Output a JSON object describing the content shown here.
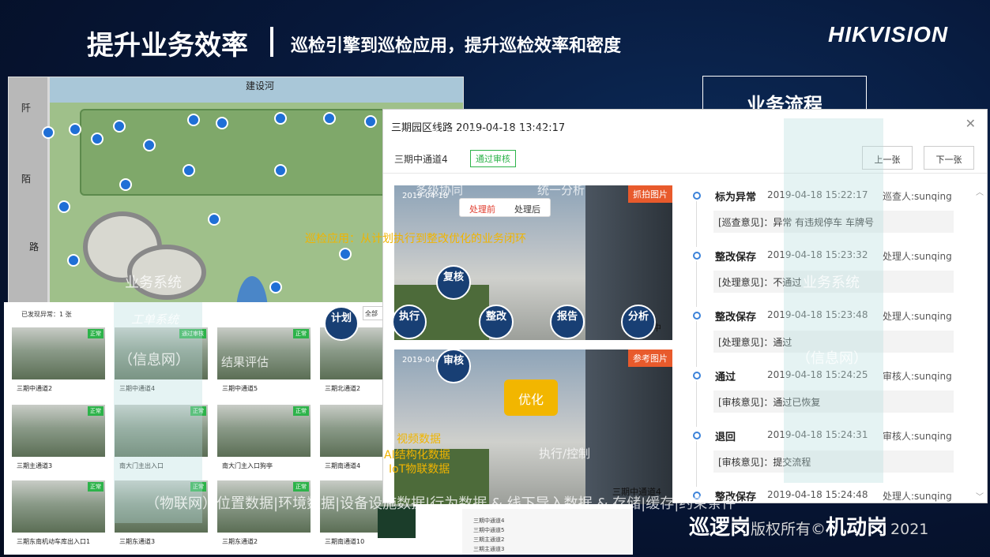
{
  "slide": {
    "title": "提升业务效率",
    "subtitle": "巡检引擎到巡检应用，提升巡检效率和密度",
    "logo": "HIKVISION",
    "flow_tab": "业务流程",
    "footer_brand_left": "巡逻岗",
    "footer_copy": "版权所有©",
    "footer_brand_right": "机动岗",
    "footer_year": "2021"
  },
  "map": {
    "labels": {
      "river": "建设河",
      "road_a": "阡",
      "road_b": "陌",
      "road_c": "路",
      "sys": "业务系统"
    }
  },
  "grid": {
    "header": "已发现异常：1 张",
    "filter": "全部",
    "tiles": [
      {
        "cap": "三期中通道2",
        "tag": "正常"
      },
      {
        "cap": "三期中通道4",
        "tag": "通过审核"
      },
      {
        "cap": "三期中通道5",
        "tag": "正常"
      },
      {
        "cap": "三期北通道2",
        "tag": "正常"
      },
      {
        "cap": "三期主通道3",
        "tag": "正常"
      },
      {
        "cap": "南大门主出入口",
        "tag": "正常"
      },
      {
        "cap": "南大门主入口狗亭",
        "tag": "正常"
      },
      {
        "cap": "三期南通道4",
        "tag": "正常"
      },
      {
        "cap": "三期东南机动车库出入口1",
        "tag": "正常"
      },
      {
        "cap": "三期东通道3",
        "tag": "正常"
      },
      {
        "cap": "三期东通道2",
        "tag": "正常"
      },
      {
        "cap": "三期南通道10",
        "tag": "正常"
      }
    ],
    "list": [
      "三期中通道4",
      "三期中通道5",
      "三期主通道2",
      "三期主通道3"
    ]
  },
  "window": {
    "title": "三期园区线路 2019-04-18 13:42:17",
    "sub": "三期中通道4",
    "badge": "通过审核",
    "prev": "上一张",
    "next": "下一张",
    "photo1": {
      "ts": "2019-04-18",
      "tag": "抓拍图片",
      "cap": "三期中"
    },
    "seg": {
      "before": "处理前",
      "after": "处理后"
    },
    "photo2": {
      "ts": "2019-04-18",
      "tag": "参考图片",
      "cap": "三期中通道4"
    },
    "timeline": [
      {
        "title": "标为异常",
        "time": "2019-04-18 15:22:17",
        "person": "巡查人:sunqing",
        "note": "[巡查意见]：异常 有违规停车 车牌号"
      },
      {
        "title": "整改保存",
        "time": "2019-04-18 15:23:32",
        "person": "处理人:sunqing",
        "note": "[处理意见]：不通过"
      },
      {
        "title": "整改保存",
        "time": "2019-04-18 15:23:48",
        "person": "处理人:sunqing",
        "note": "[处理意见]：通过"
      },
      {
        "title": "通过",
        "time": "2019-04-18 15:24:25",
        "person": "审核人:sunqing",
        "note": "[审核意见]：通过已恢复"
      },
      {
        "title": "退回",
        "time": "2019-04-18 15:24:31",
        "person": "审核人:sunqing",
        "note": "[审核意见]：提交流程"
      },
      {
        "title": "整改保存",
        "time": "2019-04-18 15:24:48",
        "person": "处理人:sunqing",
        "note": ""
      }
    ]
  },
  "overlay": {
    "top1": "业务级联|数据级联",
    "top2": "多级协同",
    "top3": "统一分析",
    "loop": "巡检应用：从计划执行到整改优化的业务闭环",
    "biz1": "业务系统",
    "work": "工单系统",
    "info1": "（信息网）",
    "eval": "结果评估",
    "biz2": "业务系统",
    "info2": "（信息网）",
    "plan": "计划",
    "review": "复核",
    "execute": "执行",
    "rectify": "整改",
    "report": "报告",
    "analyze": "分析",
    "audit": "审核",
    "optimize": "优化",
    "data1": "视频数据",
    "data2": "AI结构化数据",
    "data3": "IoT物联数据",
    "ctrl": "执行/控制",
    "bottom": "（物联网）位置数据|环境数据|设备设施数据|行为数据 & 线下导入数据 & 存储|缓存|约束条件"
  }
}
